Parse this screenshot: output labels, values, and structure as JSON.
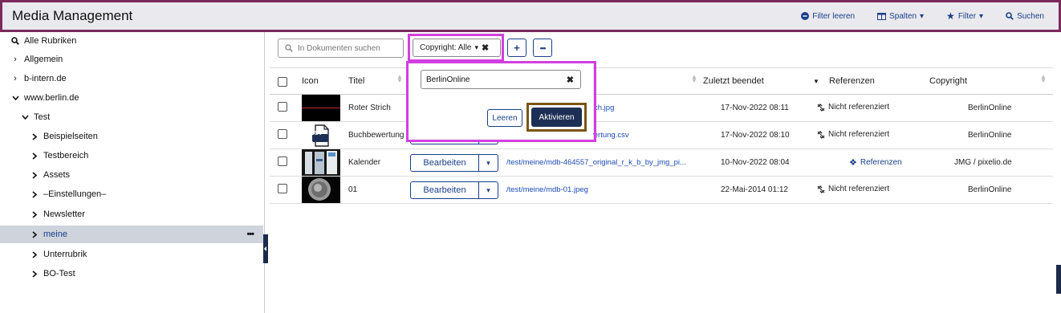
{
  "header": {
    "title": "Media Management",
    "tools": {
      "clear_filter": "Filter leeren",
      "columns": "Spalten",
      "filter": "Filter",
      "search": "Suchen"
    }
  },
  "sidebar": {
    "items": [
      {
        "label": "Alle Rubriken",
        "icon": "search-icon"
      },
      {
        "label": "Allgemein",
        "icon": "chevron-right-icon"
      },
      {
        "label": "b-intern.de",
        "icon": "chevron-right-icon"
      },
      {
        "label": "www.berlin.de",
        "icon": "chevron-down-icon"
      },
      {
        "label": "Test",
        "icon": "chevron-down-icon"
      },
      {
        "label": "Beispielseiten",
        "icon": "chevron-right-icon"
      },
      {
        "label": "Testbereich",
        "icon": "chevron-right-icon"
      },
      {
        "label": "Assets",
        "icon": "chevron-right-icon"
      },
      {
        "label": "–Einstellungen–",
        "icon": "chevron-right-icon"
      },
      {
        "label": "Newsletter",
        "icon": "chevron-right-icon"
      },
      {
        "label": "meine",
        "icon": "chevron-right-icon",
        "more": "•••"
      },
      {
        "label": "Unterrubrik",
        "icon": "chevron-right-icon"
      },
      {
        "label": "BO-Test",
        "icon": "chevron-right-icon"
      }
    ]
  },
  "toolbar": {
    "search_placeholder": "In Dokumenten suchen",
    "filter_chip": "Copyright: Alle",
    "add": "+",
    "more": "•••"
  },
  "table": {
    "headers": {
      "icon": "Icon",
      "title": "Titel",
      "last_finished": "Zuletzt beendet",
      "references": "Referenzen",
      "copyright": "Copyright"
    },
    "edit_label": "Bearbeiten",
    "rows": [
      {
        "title": "Roter Strich",
        "path": "ch.jpg",
        "date": "17-Nov-2022 08:11",
        "ref": "Nicht referenziert",
        "copyright": "BerlinOnline"
      },
      {
        "title": "Buchbewertung",
        "path": "/test/meine/mdb-buchbewertung.csv",
        "date": "17-Nov-2022 08:10",
        "ref": "Nicht referenziert",
        "copyright": "BerlinOnline",
        "csv_label": "CSV"
      },
      {
        "title": "Kalender",
        "path": "/test/meine/mdb-464557_original_r_k_b_by_jmg_pi...",
        "date": "10-Nov-2022 08:04",
        "ref": "Referenzen",
        "copyright": "JMG / pixelio.de"
      },
      {
        "title": "01",
        "path": "/test/meine/mdb-01.jpeg",
        "date": "22-Mai-2014 01:12",
        "ref": "Nicht referenziert",
        "copyright": "BerlinOnline"
      }
    ]
  },
  "popup": {
    "input_value": "BerlinOnline",
    "clear_label": "Leeren",
    "activate_label": "Aktivieren"
  },
  "colors": {
    "header_border": "#7b2a5c",
    "highlight": "#d23fe0",
    "accent": "#1a3f8a",
    "active_bg": "#cfd3dc"
  }
}
